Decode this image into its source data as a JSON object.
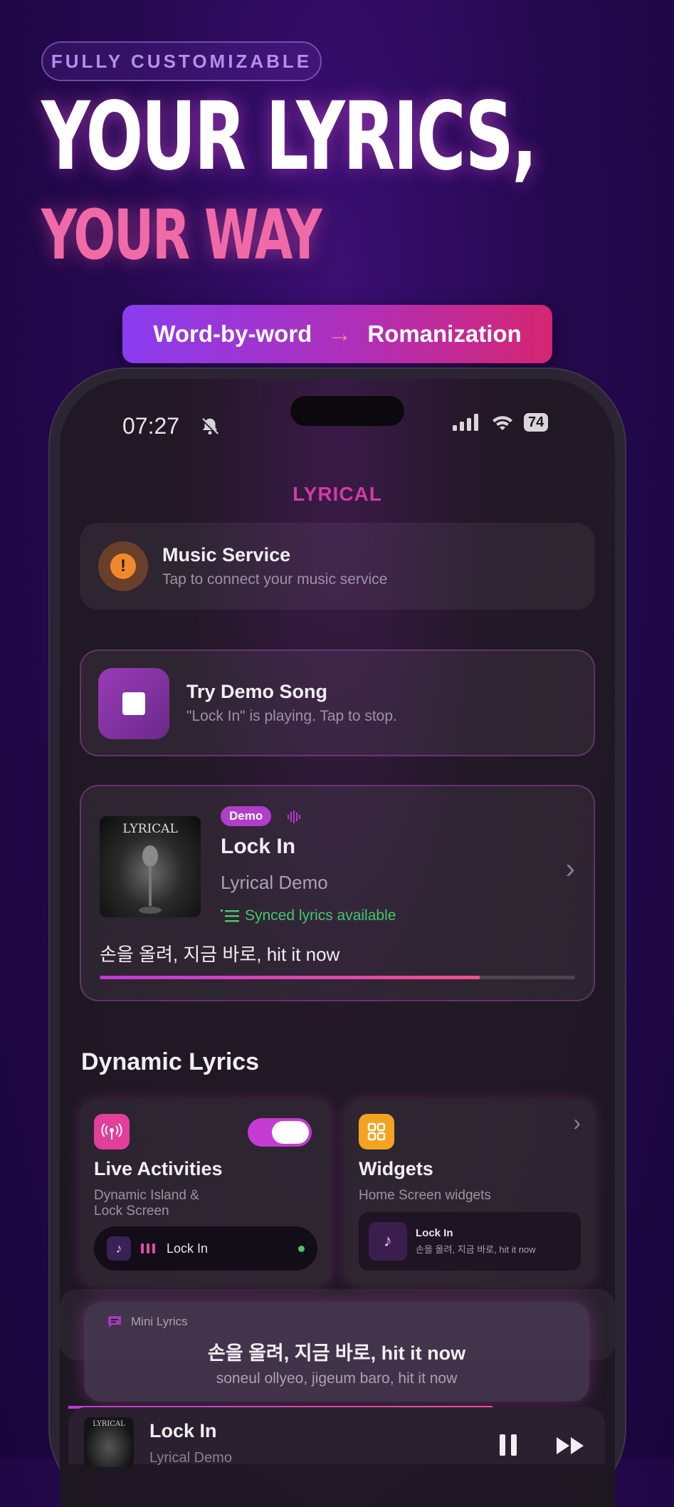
{
  "headline": {
    "tag": "FULLY CUSTOMIZABLE",
    "line1": "YOUR LYRICS,",
    "line2": "YOUR WAY"
  },
  "feature_pill": {
    "left": "Word-by-word",
    "arrow": "→",
    "right": "Romanization"
  },
  "status_bar": {
    "time": "07:27",
    "battery": "74"
  },
  "app": {
    "brand": "LYRICAL"
  },
  "music_service": {
    "icon": "!",
    "title": "Music Service",
    "subtitle": "Tap to connect your music service"
  },
  "demo_song": {
    "title": "Try Demo Song",
    "subtitle": "\"Lock In\" is playing. Tap to stop."
  },
  "now_playing": {
    "art_text": "LYRICAL",
    "badge": "Demo",
    "title": "Lock In",
    "artist": "Lyrical Demo",
    "synced": "Synced lyrics available",
    "lyric": "손을 올려, 지금 바로, hit it now",
    "progress": 0.8
  },
  "dynamic": {
    "section_title": "Dynamic Lyrics",
    "live": {
      "title": "Live Activities",
      "subtitle_line1": "Dynamic Island &",
      "subtitle_line2": "Lock Screen",
      "track": "Lock In",
      "enabled": true
    },
    "widgets": {
      "title": "Widgets",
      "subtitle": "Home Screen widgets",
      "track": "Lock In",
      "lyric": "손을 올려, 지금 바로, hit it now"
    }
  },
  "mini_lyrics": {
    "label": "Mini Lyrics",
    "lyric": "손을 올려, 지금 바로, hit it now",
    "romanized": "soneul ollyeo, jigeum baro, hit it now"
  },
  "player": {
    "art_text": "LYRICAL",
    "title": "Lock In",
    "artist": "Lyrical Demo",
    "progress": 0.79
  },
  "colors": {
    "accent": "#d43aa4",
    "pink": "#f06aa7",
    "green": "#42c96a"
  }
}
